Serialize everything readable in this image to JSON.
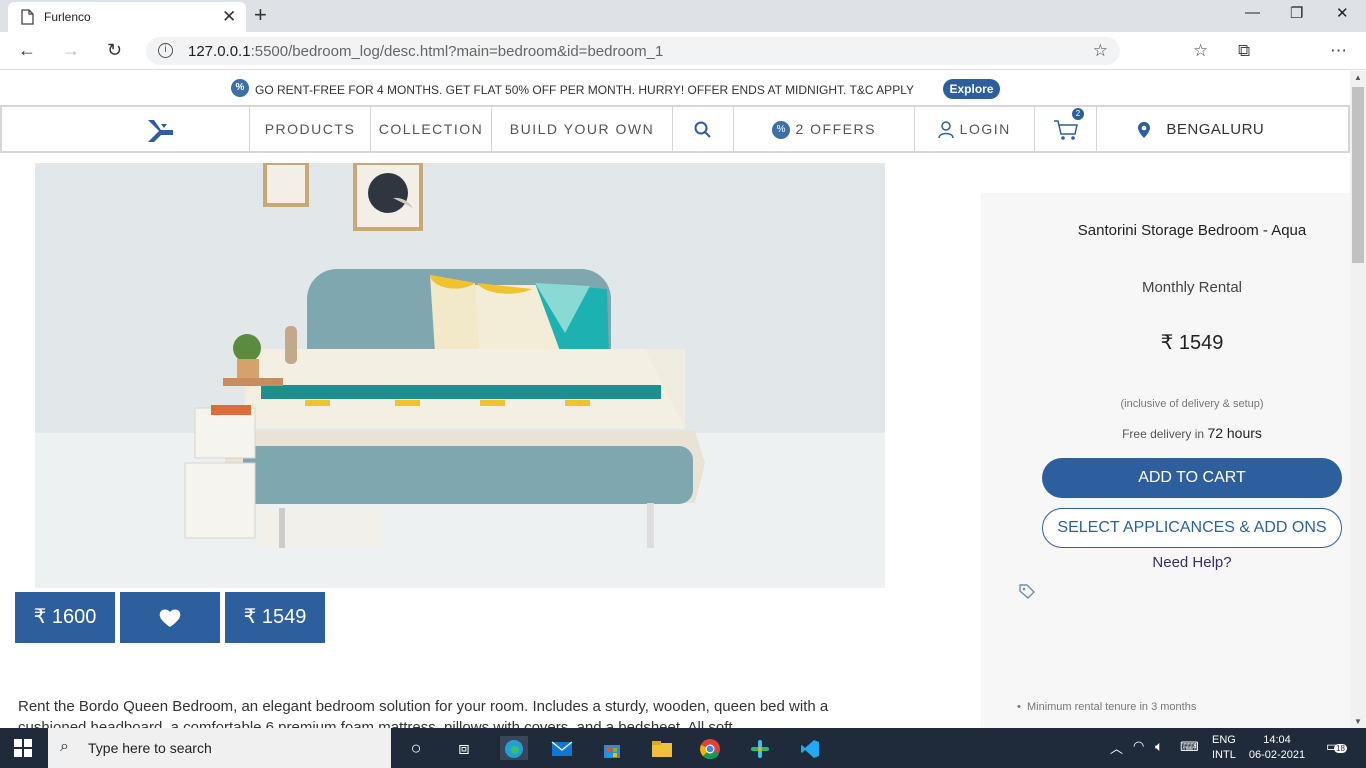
{
  "browser": {
    "tab_title": "Furlenco",
    "url_host": "127.0.0.1",
    "url_rest": ":5500/bedroom_log/desc.html?main=bedroom&id=bedroom_1"
  },
  "promo": {
    "message": "GO RENT-FREE FOR 4 MONTHS. GET FLAT 50% OFF PER MONTH. HURRY! OFFER ENDS AT MIDNIGHT. T&C APPLY",
    "explore_label": "Explore",
    "badge_symbol": "%"
  },
  "nav": {
    "products": "PRODUCTS",
    "collection": "COLLECTION",
    "build": "BUILD YOUR OWN",
    "offers": "2 OFFERS",
    "login": "LOGIN",
    "cart_count": "2",
    "city": "BENGALURU"
  },
  "product": {
    "price_left": "₹ 1600",
    "price_right": "₹ 1549",
    "description": "Rent the Bordo Queen Bedroom, an elegant bedroom solution for your room. Includes a sturdy, wooden, queen bed with a cushioned headboard, a comfortable 6 premium foam mattress, pillows with covers, and a bedsheet. All soft"
  },
  "side": {
    "name": "Santorini Storage Bedroom - Aqua",
    "rental_label": "Monthly Rental",
    "price": "₹ 1549",
    "inclusive": "(inclusive of delivery & setup)",
    "free_delivery_prefix": "Free delivery in ",
    "free_delivery_time": "72 hours",
    "add_to_cart": "ADD TO CART",
    "select_addons": "SELECT APPLICANCES & ADD ONS",
    "need_help": "Need Help?",
    "tenure": "Minimum rental tenure in 3 months"
  },
  "taskbar": {
    "search_placeholder": "Type here to search",
    "lang_top": "ENG",
    "lang_bottom": "INTL",
    "time": "14:04",
    "date": "06-02-2021",
    "notif_count": "18"
  },
  "colors": {
    "brand_blue": "#2d5f9e",
    "help_purple": "#3b2a6e"
  }
}
